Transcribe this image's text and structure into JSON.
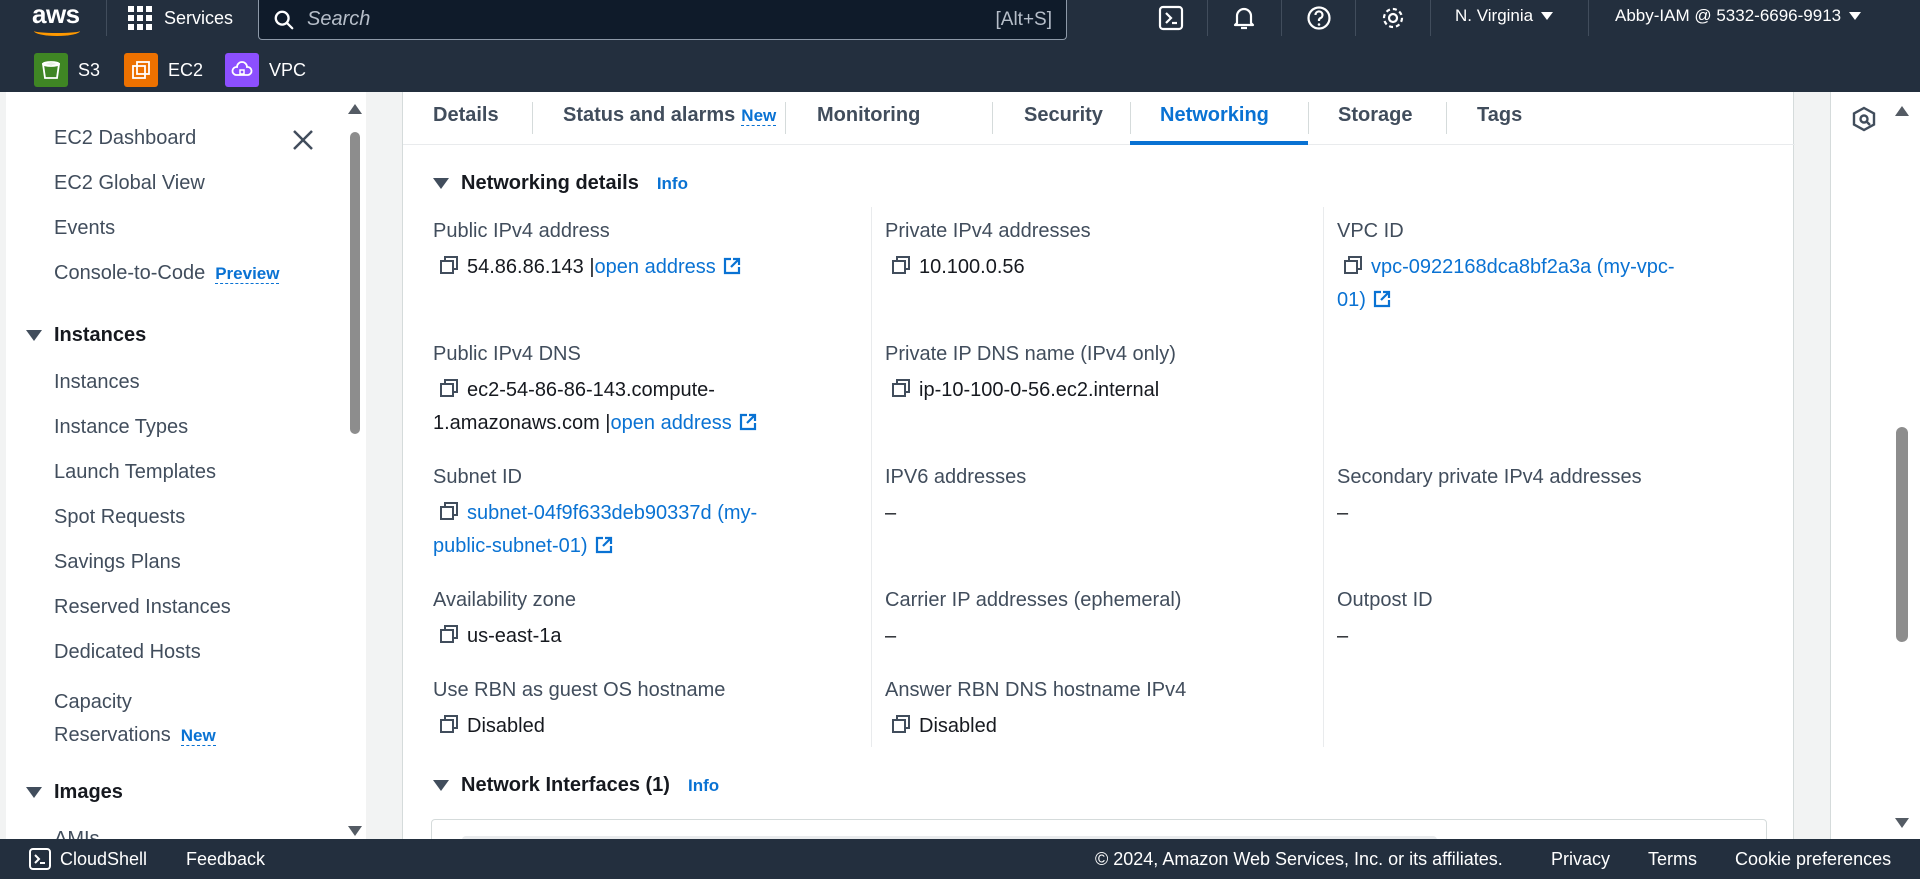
{
  "topbar": {
    "logo_text": "aws",
    "services_label": "Services",
    "search_placeholder": "Search",
    "search_shortcut": "[Alt+S]",
    "region": "N. Virginia",
    "account": "Abby-IAM @ 5332-6696-9913"
  },
  "favorites": [
    {
      "label": "S3",
      "color": "#3f8624"
    },
    {
      "label": "EC2",
      "color": "#ed7100"
    },
    {
      "label": "VPC",
      "color": "#8c4fff"
    }
  ],
  "sidebar": {
    "items_top": [
      "EC2 Dashboard",
      "EC2 Global View",
      "Events",
      "Console-to-Code"
    ],
    "preview_badge": "Preview",
    "section_instances": "Instances",
    "instances_items": [
      "Instances",
      "Instance Types",
      "Launch Templates",
      "Spot Requests",
      "Savings Plans",
      "Reserved Instances",
      "Dedicated Hosts",
      "Capacity",
      "Reservations"
    ],
    "new_badge": "New",
    "section_images": "Images",
    "images_items": [
      "AMIs"
    ]
  },
  "tabs": [
    {
      "label": "Details"
    },
    {
      "label": "Status and alarms",
      "badge": "New"
    },
    {
      "label": "Monitoring"
    },
    {
      "label": "Security"
    },
    {
      "label": "Networking",
      "active": true
    },
    {
      "label": "Storage"
    },
    {
      "label": "Tags"
    }
  ],
  "networking": {
    "title": "Networking details",
    "info": "Info",
    "public_ipv4_label": "Public IPv4 address",
    "public_ipv4_value": "54.86.86.143",
    "open_address": "open address",
    "private_ipv4_label": "Private IPv4 addresses",
    "private_ipv4_value": "10.100.0.56",
    "vpc_label": "VPC ID",
    "vpc_value_line1": "vpc-0922168dca8bf2a3a (my-vpc-",
    "vpc_value_line2": "01)",
    "public_dns_label": "Public IPv4 DNS",
    "public_dns_line1": "ec2-54-86-86-143.compute-",
    "public_dns_line2": "1.amazonaws.com",
    "private_dns_label": "Private IP DNS name (IPv4 only)",
    "private_dns_value": "ip-10-100-0-56.ec2.internal",
    "subnet_label": "Subnet ID",
    "subnet_line1": "subnet-04f9f633deb90337d (my-",
    "subnet_line2": "public-subnet-01)",
    "ipv6_label": "IPV6 addresses",
    "ipv6_value": "–",
    "secondary_label": "Secondary private IPv4 addresses",
    "secondary_value": "–",
    "az_label": "Availability zone",
    "az_value": "us-east-1a",
    "carrier_label": "Carrier IP addresses (ephemeral)",
    "carrier_value": "–",
    "outpost_label": "Outpost ID",
    "outpost_value": "–",
    "rbn_label": "Use RBN as guest OS hostname",
    "rbn_value": "Disabled",
    "answer_rbn_label": "Answer RBN DNS hostname IPv4",
    "answer_rbn_value": "Disabled"
  },
  "interfaces": {
    "title": "Network Interfaces (1)",
    "info": "Info"
  },
  "footer": {
    "cloudshell": "CloudShell",
    "feedback": "Feedback",
    "copyright": "© 2024, Amazon Web Services, Inc. or its affiliates.",
    "privacy": "Privacy",
    "terms": "Terms",
    "cookies": "Cookie preferences"
  }
}
